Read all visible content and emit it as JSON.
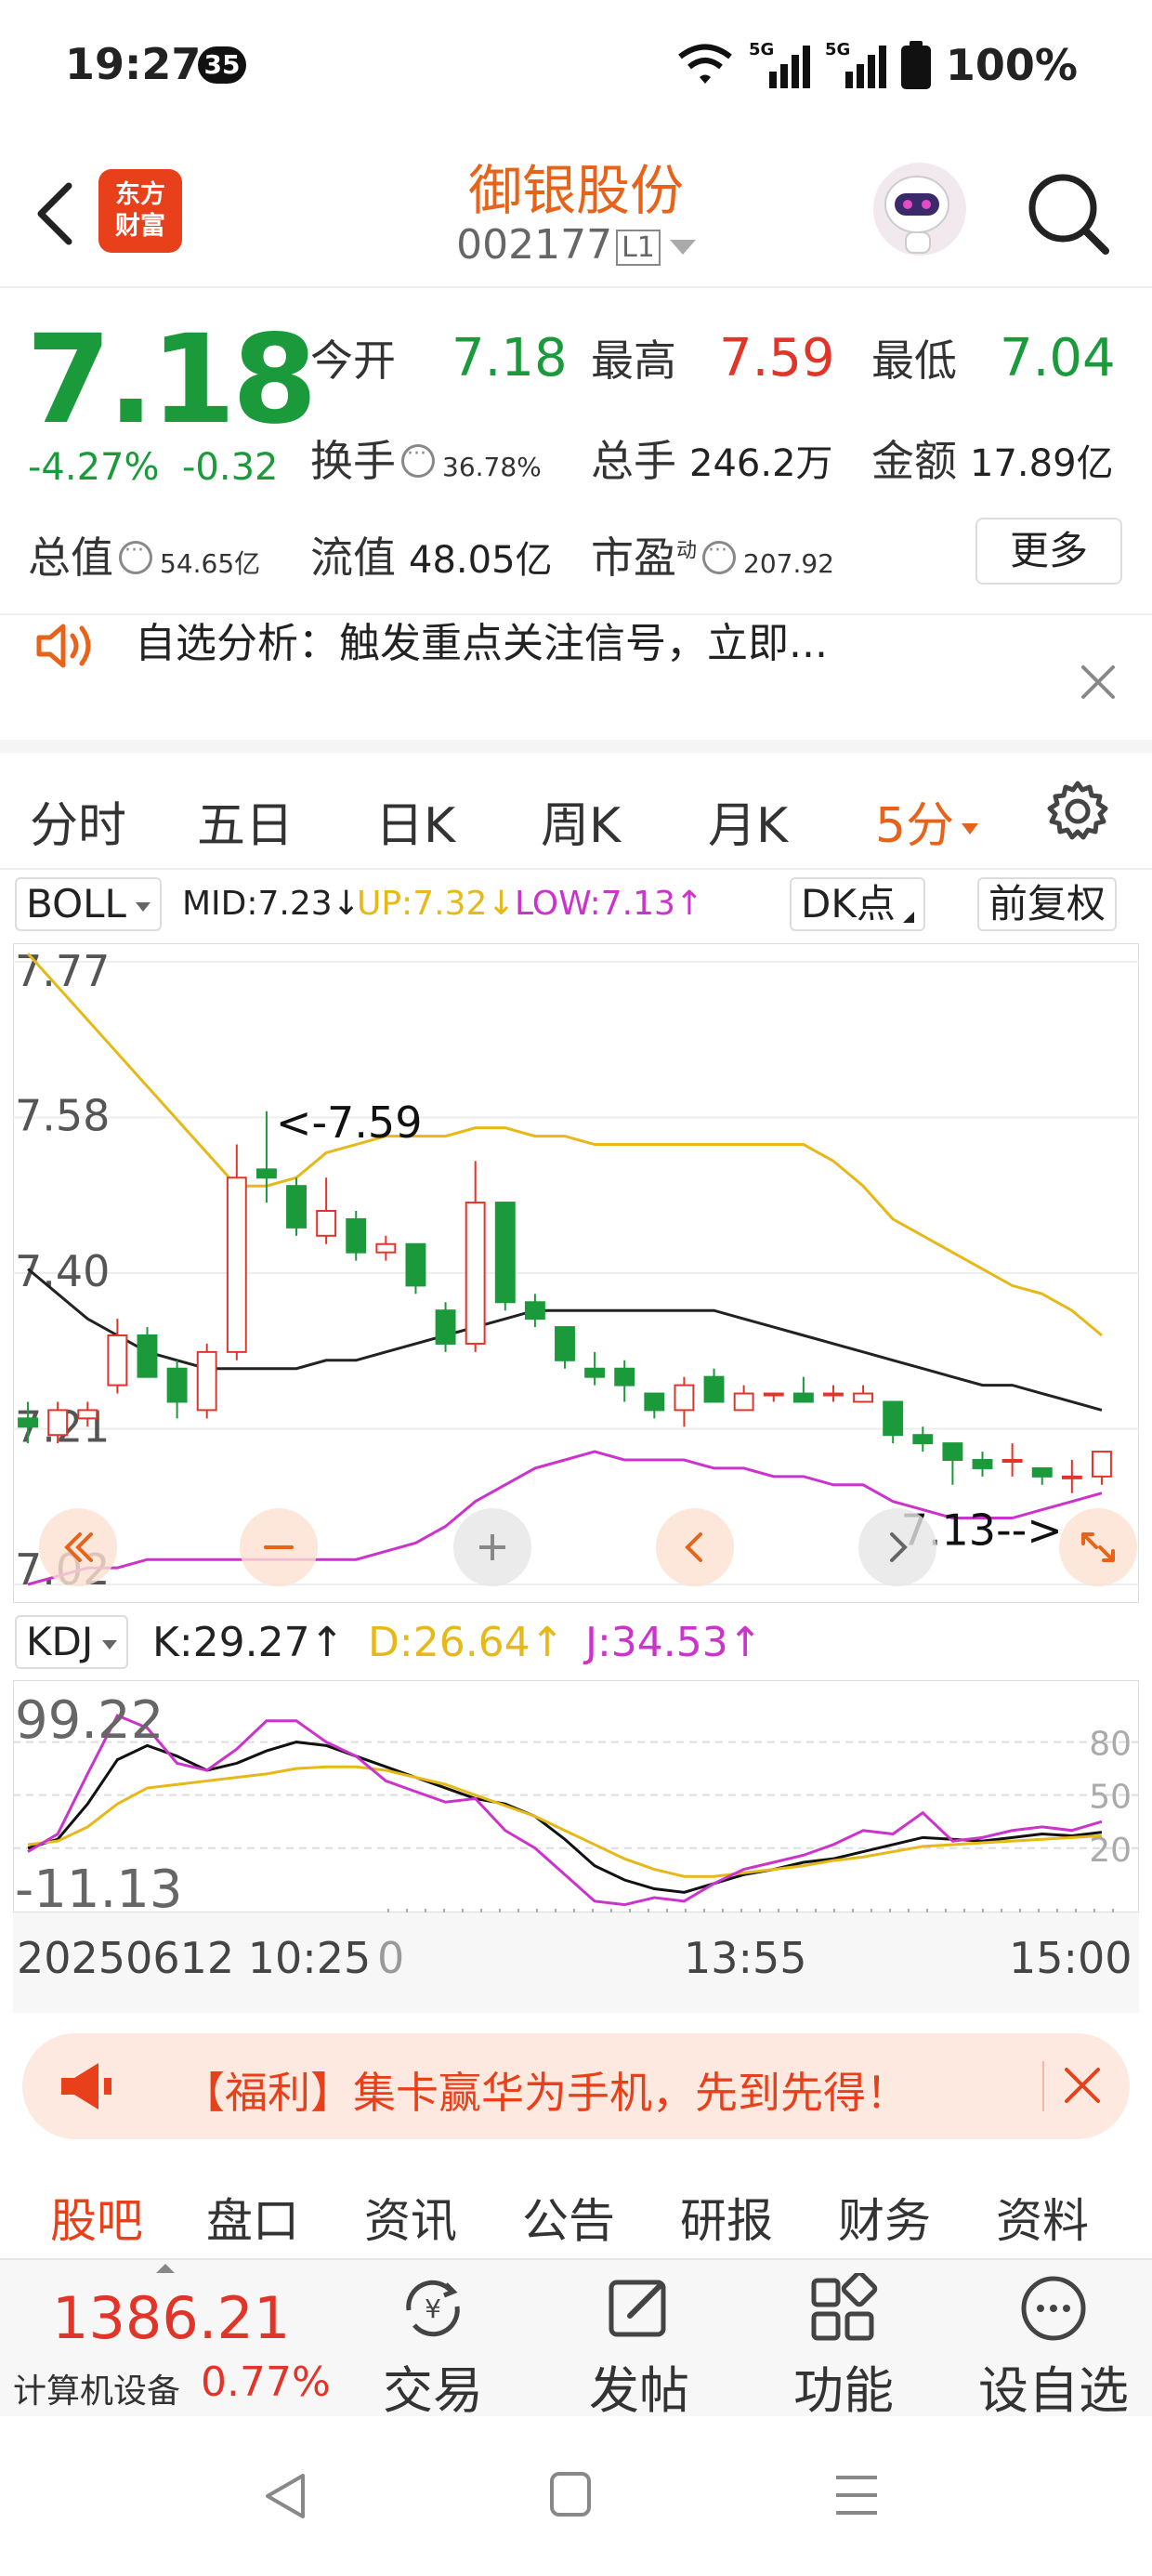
{
  "status_bar": {
    "time": "19:27",
    "notif_count": "35",
    "network_1": "5G",
    "network_2": "5G",
    "battery": "100%"
  },
  "header": {
    "logo_line1": "东方",
    "logo_line2": "财富",
    "stock_name": "御银股份",
    "stock_code": "002177",
    "level_badge": "L1"
  },
  "quote": {
    "price": "7.18",
    "change_pct": "-4.27%",
    "change_abs": "-0.32",
    "open_label": "今开",
    "open": "7.18",
    "high_label": "最高",
    "high": "7.59",
    "low_label": "最低",
    "low": "7.04",
    "turnover_label": "换手",
    "turnover": "36.78%",
    "volume_label": "总手",
    "volume": "246.2万",
    "amount_label": "金额",
    "amount": "17.89亿",
    "mktcap_label": "总值",
    "mktcap": "54.65亿",
    "float_label": "流值",
    "float_cap": "48.05亿",
    "pe_label": "市盈",
    "pe_sup": "动",
    "pe": "207.92",
    "more_label": "更多"
  },
  "notice": {
    "text": "自选分析：触发重点关注信号，立即..."
  },
  "period_tabs": [
    "分时",
    "五日",
    "日K",
    "周K",
    "月K",
    "5分"
  ],
  "active_period": "5分",
  "boll": {
    "selector": "BOLL",
    "mid": "MID:7.23↓",
    "up": "UP:7.32↓",
    "low": "LOW:7.13↑",
    "dk_label": "DK点",
    "adjust_label": "前复权",
    "y_ticks": [
      "7.77",
      "7.58",
      "7.40",
      "7.21",
      "7.02"
    ],
    "high_marker": "<-7.59",
    "low_marker": "7.13-->"
  },
  "kdj": {
    "selector": "KDJ",
    "k": "K:29.27↑",
    "d": "D:26.64↑",
    "j": "J:34.53↑",
    "y_max": "99.22",
    "y_min": "-11.13",
    "levels": [
      "80",
      "50",
      "20"
    ]
  },
  "time_axis": {
    "start": "20250612 10:25",
    "zero": "0",
    "mid": "13:55",
    "end": "15:00"
  },
  "promo": {
    "text": "【福利】集卡赢华为手机，先到先得！"
  },
  "bottom_tabs": [
    "股吧",
    "盘口",
    "资讯",
    "公告",
    "研报",
    "财务",
    "资料"
  ],
  "footer": {
    "index_value": "1386.21",
    "index_name": "计算机设备",
    "index_pct": "0.77%",
    "trade_label": "交易",
    "post_label": "发帖",
    "function_label": "功能",
    "watch_label": "设自选"
  },
  "colors": {
    "up": "#e2352a",
    "down": "#1a9a3a",
    "accent": "#e8631a",
    "boll_up": "#e6b818",
    "boll_low": "#cc33cc",
    "boll_mid": "#222222"
  },
  "chart_data": [
    {
      "type": "candlestick",
      "title": "5分 K线 BOLL",
      "ylim": [
        7.02,
        7.77
      ],
      "candles": [
        {
          "o": 7.22,
          "h": 7.24,
          "l": 7.19,
          "c": 7.21
        },
        {
          "o": 7.2,
          "h": 7.24,
          "l": 7.19,
          "c": 7.23
        },
        {
          "o": 7.22,
          "h": 7.24,
          "l": 7.21,
          "c": 7.23
        },
        {
          "o": 7.26,
          "h": 7.34,
          "l": 7.25,
          "c": 7.32
        },
        {
          "o": 7.32,
          "h": 7.33,
          "l": 7.27,
          "c": 7.27
        },
        {
          "o": 7.28,
          "h": 7.29,
          "l": 7.22,
          "c": 7.24
        },
        {
          "o": 7.23,
          "h": 7.31,
          "l": 7.22,
          "c": 7.3
        },
        {
          "o": 7.3,
          "h": 7.55,
          "l": 7.29,
          "c": 7.51
        },
        {
          "o": 7.52,
          "h": 7.59,
          "l": 7.48,
          "c": 7.51
        },
        {
          "o": 7.5,
          "h": 7.51,
          "l": 7.44,
          "c": 7.45
        },
        {
          "o": 7.44,
          "h": 7.51,
          "l": 7.43,
          "c": 7.47
        },
        {
          "o": 7.46,
          "h": 7.47,
          "l": 7.41,
          "c": 7.42
        },
        {
          "o": 7.42,
          "h": 7.44,
          "l": 7.41,
          "c": 7.43
        },
        {
          "o": 7.43,
          "h": 7.43,
          "l": 7.37,
          "c": 7.38
        },
        {
          "o": 7.35,
          "h": 7.36,
          "l": 7.3,
          "c": 7.31
        },
        {
          "o": 7.31,
          "h": 7.53,
          "l": 7.3,
          "c": 7.48
        },
        {
          "o": 7.48,
          "h": 7.48,
          "l": 7.35,
          "c": 7.36
        },
        {
          "o": 7.36,
          "h": 7.37,
          "l": 7.33,
          "c": 7.34
        },
        {
          "o": 7.33,
          "h": 7.33,
          "l": 7.28,
          "c": 7.29
        },
        {
          "o": 7.28,
          "h": 7.3,
          "l": 7.26,
          "c": 7.27
        },
        {
          "o": 7.28,
          "h": 7.29,
          "l": 7.24,
          "c": 7.26
        },
        {
          "o": 7.25,
          "h": 7.25,
          "l": 7.22,
          "c": 7.23
        },
        {
          "o": 7.23,
          "h": 7.27,
          "l": 7.21,
          "c": 7.26
        },
        {
          "o": 7.27,
          "h": 7.28,
          "l": 7.24,
          "c": 7.24
        },
        {
          "o": 7.23,
          "h": 7.26,
          "l": 7.23,
          "c": 7.25
        },
        {
          "o": 7.25,
          "h": 7.25,
          "l": 7.24,
          "c": 7.25
        },
        {
          "o": 7.25,
          "h": 7.27,
          "l": 7.24,
          "c": 7.24
        },
        {
          "o": 7.25,
          "h": 7.26,
          "l": 7.24,
          "c": 7.25
        },
        {
          "o": 7.24,
          "h": 7.26,
          "l": 7.24,
          "c": 7.25
        },
        {
          "o": 7.24,
          "h": 7.24,
          "l": 7.19,
          "c": 7.2
        },
        {
          "o": 7.2,
          "h": 7.21,
          "l": 7.18,
          "c": 7.19
        },
        {
          "o": 7.19,
          "h": 7.19,
          "l": 7.14,
          "c": 7.17
        },
        {
          "o": 7.17,
          "h": 7.18,
          "l": 7.15,
          "c": 7.16
        },
        {
          "o": 7.17,
          "h": 7.19,
          "l": 7.15,
          "c": 7.17
        },
        {
          "o": 7.16,
          "h": 7.16,
          "l": 7.14,
          "c": 7.15
        },
        {
          "o": 7.15,
          "h": 7.17,
          "l": 7.13,
          "c": 7.15
        },
        {
          "o": 7.15,
          "h": 7.18,
          "l": 7.14,
          "c": 7.18
        }
      ],
      "boll_up": [
        7.78,
        7.74,
        7.7,
        7.66,
        7.62,
        7.58,
        7.54,
        7.5,
        7.5,
        7.51,
        7.54,
        7.55,
        7.56,
        7.56,
        7.56,
        7.57,
        7.57,
        7.56,
        7.56,
        7.55,
        7.55,
        7.55,
        7.55,
        7.55,
        7.55,
        7.55,
        7.55,
        7.53,
        7.5,
        7.46,
        7.44,
        7.42,
        7.4,
        7.38,
        7.37,
        7.35,
        7.32
      ],
      "boll_mid": [
        7.4,
        7.37,
        7.34,
        7.32,
        7.3,
        7.29,
        7.28,
        7.28,
        7.28,
        7.28,
        7.29,
        7.29,
        7.3,
        7.31,
        7.32,
        7.33,
        7.34,
        7.35,
        7.35,
        7.35,
        7.35,
        7.35,
        7.35,
        7.35,
        7.34,
        7.33,
        7.32,
        7.31,
        7.3,
        7.29,
        7.28,
        7.27,
        7.26,
        7.26,
        7.25,
        7.24,
        7.23
      ],
      "boll_low": [
        7.02,
        7.03,
        7.04,
        7.04,
        7.05,
        7.05,
        7.05,
        7.05,
        7.05,
        7.05,
        7.05,
        7.05,
        7.06,
        7.07,
        7.09,
        7.12,
        7.14,
        7.16,
        7.17,
        7.18,
        7.17,
        7.17,
        7.17,
        7.16,
        7.16,
        7.15,
        7.15,
        7.14,
        7.14,
        7.12,
        7.11,
        7.1,
        7.1,
        7.1,
        7.11,
        7.12,
        7.13
      ]
    },
    {
      "type": "line",
      "title": "KDJ",
      "ylim": [
        -11.13,
        99.22
      ],
      "series": [
        {
          "name": "K",
          "values": [
            20,
            25,
            45,
            70,
            78,
            72,
            64,
            68,
            75,
            80,
            78,
            72,
            66,
            60,
            54,
            48,
            45,
            38,
            25,
            10,
            2,
            -3,
            -5,
            0,
            5,
            8,
            12,
            14,
            18,
            22,
            26,
            25,
            24,
            26,
            28,
            27,
            29
          ]
        },
        {
          "name": "D",
          "values": [
            22,
            24,
            32,
            45,
            54,
            56,
            58,
            60,
            62,
            65,
            66,
            66,
            64,
            60,
            56,
            50,
            44,
            38,
            30,
            22,
            14,
            8,
            4,
            4,
            6,
            8,
            10,
            13,
            15,
            18,
            21,
            22,
            23,
            24,
            25,
            26,
            27
          ]
        },
        {
          "name": "J",
          "values": [
            18,
            28,
            62,
            95,
            88,
            68,
            64,
            76,
            92,
            92,
            80,
            72,
            58,
            52,
            46,
            48,
            30,
            20,
            5,
            -10,
            -12,
            -8,
            -10,
            0,
            8,
            12,
            16,
            22,
            30,
            28,
            40,
            24,
            26,
            30,
            32,
            30,
            35
          ]
        }
      ],
      "x_labels": [
        "10:25",
        "13:55",
        "15:00"
      ]
    }
  ]
}
